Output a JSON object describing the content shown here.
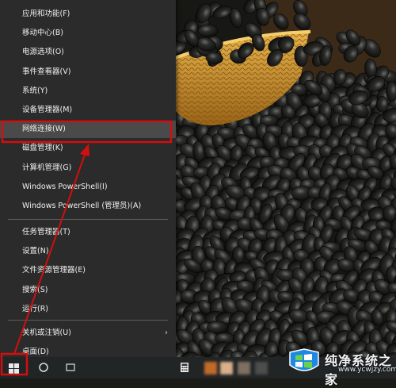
{
  "menu": {
    "groups": [
      [
        {
          "label": "应用和功能(F)"
        },
        {
          "label": "移动中心(B)"
        },
        {
          "label": "电源选项(O)"
        },
        {
          "label": "事件查看器(V)"
        },
        {
          "label": "系统(Y)"
        },
        {
          "label": "设备管理器(M)"
        },
        {
          "label": "网络连接(W)",
          "highlighted": true
        },
        {
          "label": "磁盘管理(K)"
        },
        {
          "label": "计算机管理(G)"
        },
        {
          "label": "Windows PowerShell(I)"
        },
        {
          "label": "Windows PowerShell (管理员)(A)"
        }
      ],
      [
        {
          "label": "任务管理器(T)"
        },
        {
          "label": "设置(N)"
        },
        {
          "label": "文件资源管理器(E)"
        },
        {
          "label": "搜索(S)"
        },
        {
          "label": "运行(R)"
        }
      ],
      [
        {
          "label": "关机或注销(U)",
          "submenu": true
        },
        {
          "label": "桌面(D)"
        }
      ]
    ],
    "submenu_arrow": "›"
  },
  "watermark": {
    "text": "纯净系统之家",
    "url": "www.ycwjzy.com"
  },
  "annotation_color": "#d10f0f",
  "menu_bg": "#2b2b2b",
  "highlight_bg": "#4a4a4a"
}
